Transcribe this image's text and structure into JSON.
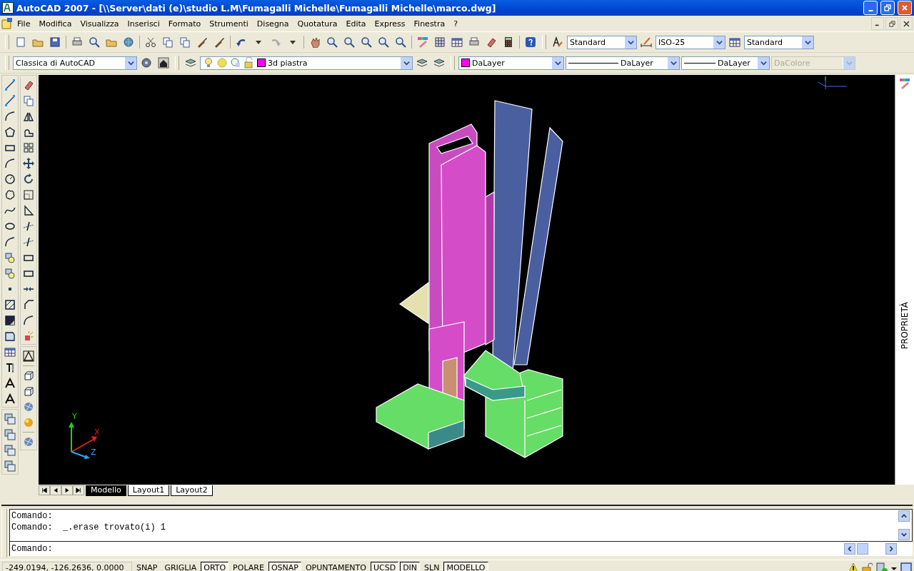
{
  "window": {
    "title": "AutoCAD 2007 - [\\\\Server\\dati (e)\\studio L.M\\Fumagalli Michelle\\Fumagalli Michelle\\marco.dwg]"
  },
  "menu": [
    "File",
    "Modifica",
    "Visualizza",
    "Inserisci",
    "Formato",
    "Strumenti",
    "Disegna",
    "Quotatura",
    "Edita",
    "Express",
    "Finestra",
    "?"
  ],
  "styles_toolbar": {
    "text_style": "Standard",
    "dim_style": "ISO-25",
    "table_style": "Standard"
  },
  "workspace": {
    "value": "Classica di AutoCAD"
  },
  "layer": {
    "value": "3d piastra",
    "color": "#ff00ff"
  },
  "properties_toolbar": [
    {
      "kind": "color",
      "value": "DaLayer",
      "color": "#ff00ff",
      "disabled": false
    },
    {
      "kind": "linetype",
      "value": "DaLayer",
      "disabled": false
    },
    {
      "kind": "lineweight",
      "value": "DaLayer",
      "disabled": false
    },
    {
      "kind": "plain",
      "value": "DaColore",
      "disabled": true
    }
  ],
  "ucs_axes": {
    "x": "X",
    "y": "Y",
    "z": "Z"
  },
  "layout_tabs": [
    {
      "label": "Modello",
      "selected": true
    },
    {
      "label": "Layout1",
      "selected": false
    },
    {
      "label": "Layout2",
      "selected": false
    }
  ],
  "palette": {
    "title": "PROPRIETÀ"
  },
  "command_history": [
    "Comando:",
    "Comando:  _.erase trovato(i) 1"
  ],
  "command_prompt": "Comando:",
  "status_bar": {
    "coordinates": "-249.0194, -126.2636, 0.0000",
    "toggles": [
      {
        "label": "SNAP",
        "on": false
      },
      {
        "label": "GRIGLIA",
        "on": false
      },
      {
        "label": "ORTO",
        "on": true
      },
      {
        "label": "POLARE",
        "on": false
      },
      {
        "label": "OSNAP",
        "on": true
      },
      {
        "label": "OPUNTAMENTO",
        "on": false
      },
      {
        "label": "UCSD",
        "on": true
      },
      {
        "label": "DIN",
        "on": true
      },
      {
        "label": "SLN",
        "on": false
      },
      {
        "label": "MODELLO",
        "on": true
      }
    ]
  }
}
